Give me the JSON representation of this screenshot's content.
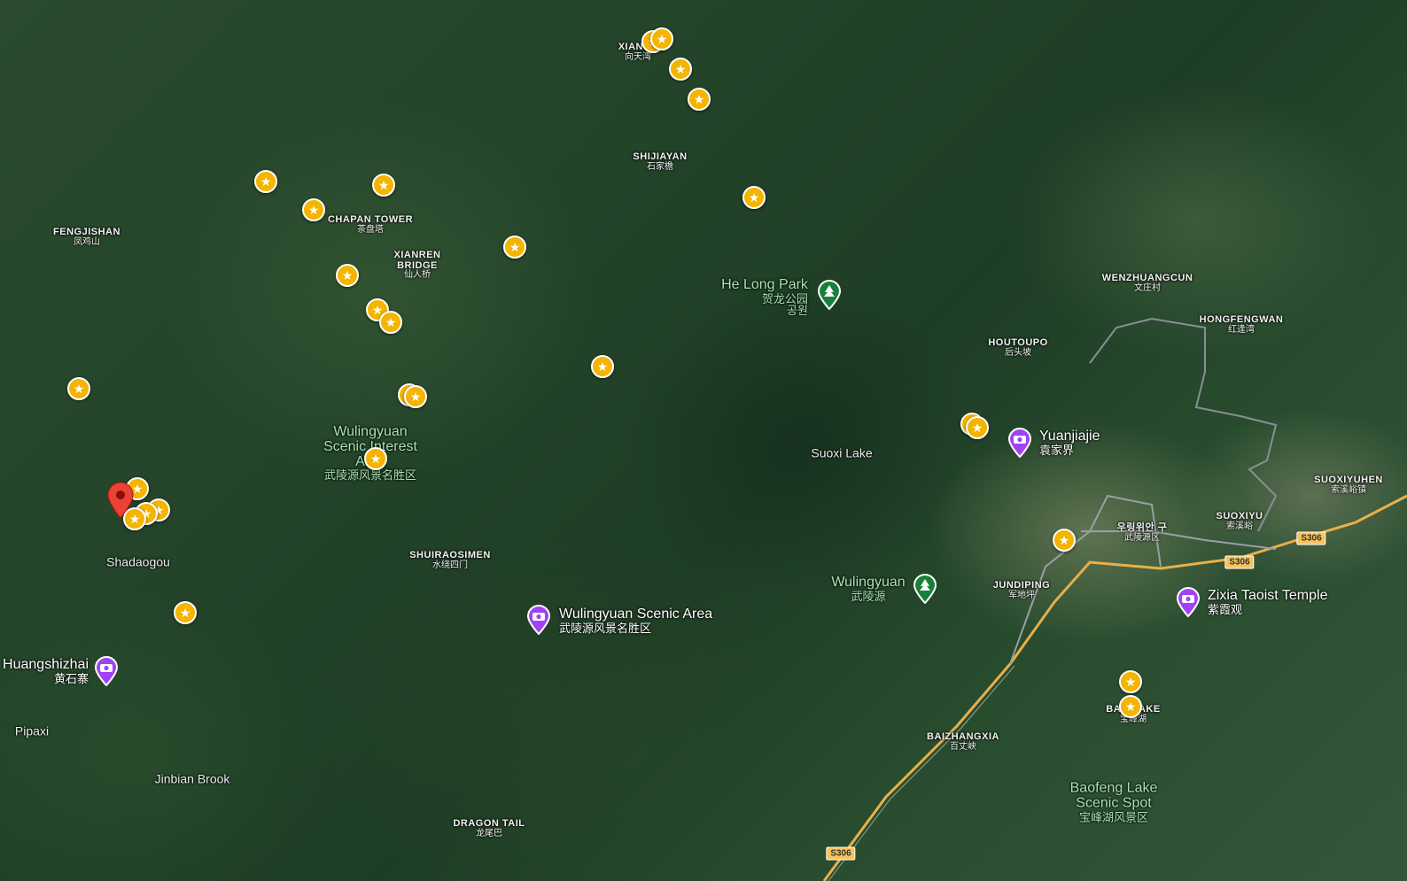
{
  "map": {
    "type": "satellite",
    "places": [
      {
        "name": "XIANGT",
        "zh": "向天湾",
        "style": "caps"
      },
      {
        "name": "SHIJIAYAN",
        "zh": "石家檐",
        "style": "caps"
      },
      {
        "name": "FENGJISHAN",
        "zh": "凤鸡山",
        "style": "caps"
      },
      {
        "name": "CHAPAN TOWER",
        "zh": "茶盘塔",
        "style": "caps"
      },
      {
        "name": "XIANREN BRIDGE",
        "zh": "仙人桥",
        "style": "caps"
      },
      {
        "name": "SHUIRAOSIMEN",
        "zh": "水绕四门",
        "style": "caps"
      },
      {
        "name": "DRAGON TAIL",
        "zh": "龙尾巴",
        "style": "caps"
      },
      {
        "name": "WENZHUANGCUN",
        "zh": "文庄村",
        "style": "caps"
      },
      {
        "name": "HONGFENGWAN",
        "zh": "红逢湾",
        "style": "caps"
      },
      {
        "name": "HOUTOUPO",
        "zh": "后头坡",
        "style": "caps"
      },
      {
        "name": "SUOXIYUHEN",
        "zh": "索溪峪镇",
        "style": "caps"
      },
      {
        "name": "SUOXIYU",
        "zh": "索溪峪",
        "style": "caps"
      },
      {
        "name": "JUNDIPING",
        "zh": "军地坪",
        "style": "caps"
      },
      {
        "name": "BAIZHANGXIA",
        "zh": "百丈峡",
        "style": "caps"
      },
      {
        "name": "BAO LAKE",
        "zh": "宝峰湖",
        "style": "caps"
      },
      {
        "name": "우링위안 구",
        "zh": "武陵源区",
        "style": "caps"
      },
      {
        "name": "Shadaogou",
        "zh": "",
        "style": "plain"
      },
      {
        "name": "Pipaxi",
        "zh": "",
        "style": "plain"
      },
      {
        "name": "Jinbian Brook",
        "zh": "",
        "style": "plain"
      },
      {
        "name": "Suoxi Lake",
        "zh": "",
        "style": "plain"
      },
      {
        "name": "Wulingyuan Scenic Interest Area",
        "zh": "武陵源风景名胜区",
        "style": "green"
      },
      {
        "name": "Baofeng Lake Scenic Spot",
        "zh": "宝峰湖风景区",
        "style": "green"
      }
    ],
    "parks": [
      {
        "name": "He Long Park",
        "zh": "贺龙公园",
        "zh2": "공원",
        "icon": "tree-icon"
      },
      {
        "name": "Wulingyuan",
        "zh": "武陵源",
        "icon": "tree-icon"
      }
    ],
    "attractions": [
      {
        "name": "Yuanjiajie",
        "zh": "袁家界",
        "icon": "camera-icon"
      },
      {
        "name": "Zixia Taoist Temple",
        "zh": "紫霞观",
        "icon": "camera-icon"
      },
      {
        "name": "Wulingyuan Scenic Area",
        "zh": "武陵源风景名胜区",
        "icon": "camera-icon"
      },
      {
        "name": "Huangshizhai",
        "zh": "黄石寨",
        "icon": "camera-icon"
      }
    ],
    "road_shields": [
      "S306",
      "S306",
      "S306"
    ],
    "saved_places_icon": "star-icon",
    "selected_pin_icon": "red-location-pin-icon",
    "colors": {
      "star": "#f4b400",
      "attraction": "#a142f4",
      "park": "#188038",
      "pin": "#ea4335",
      "road": "#f7c35b"
    }
  }
}
